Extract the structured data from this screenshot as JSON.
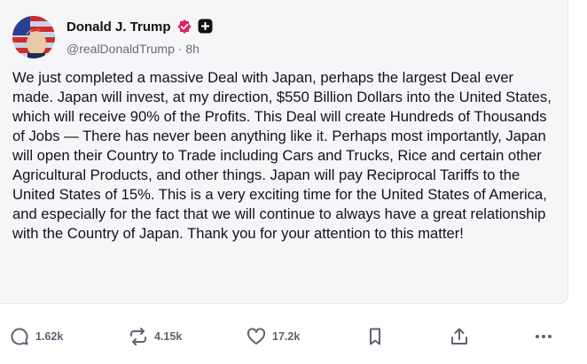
{
  "post": {
    "author_name": "Donald J. Trump",
    "handle": "@realDonaldTrump",
    "separator": "·",
    "time": "8h",
    "verified_icon": "verified-badge-icon",
    "plus_icon": "plus-badge-icon",
    "accent_color": "#e0245e",
    "text": "We just completed a massive Deal with Japan, perhaps the largest Deal ever made. Japan will invest, at my direction, $550 Billion Dollars into the United States, which will receive 90% of the Profits. This Deal will create Hundreds of Thousands of Jobs — There has never been anything like it. Perhaps most importantly, Japan will open their Country to Trade including Cars and Trucks, Rice and certain other Agricultural Products, and other things. Japan will pay Reciprocal Tariffs to the United States of 15%. This is a very exciting time for the United States of America, and especially for the fact that we will continue to always have a great relationship with the Country of Japan. Thank you for your attention to this matter!"
  },
  "actions": {
    "replies": {
      "icon": "reply-icon",
      "count": "1.62k"
    },
    "retruths": {
      "icon": "retruth-icon",
      "count": "4.15k"
    },
    "likes": {
      "icon": "heart-icon",
      "count": "17.2k"
    },
    "bookmark": {
      "icon": "bookmark-icon"
    },
    "share": {
      "icon": "share-icon"
    },
    "more": {
      "icon": "more-icon"
    }
  }
}
